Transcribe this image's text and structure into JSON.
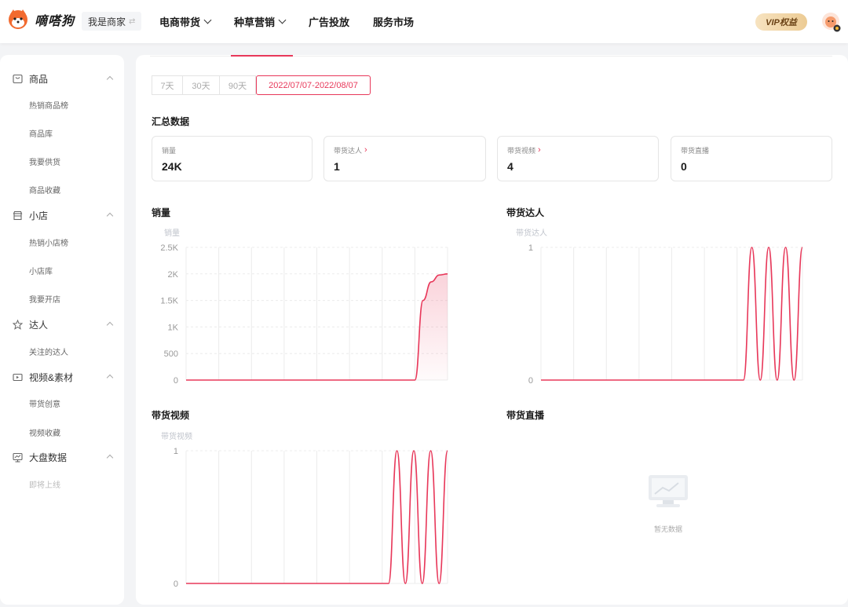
{
  "header": {
    "brand": "嘀嗒狗",
    "role_switch": "我是商家",
    "nav": [
      {
        "label": "电商带货",
        "dropdown": true
      },
      {
        "label": "种草营销",
        "dropdown": true
      },
      {
        "label": "广告投放",
        "dropdown": false
      },
      {
        "label": "服务市场",
        "dropdown": false
      }
    ],
    "vip_label": "VIP权益"
  },
  "sidebar": {
    "groups": [
      {
        "icon": "product-icon",
        "label": "商品",
        "items": [
          "热销商品榜",
          "商品库",
          "我要供货",
          "商品收藏"
        ]
      },
      {
        "icon": "store-icon",
        "label": "小店",
        "items": [
          "热销小店榜",
          "小店库",
          "我要开店"
        ]
      },
      {
        "icon": "star-person-icon",
        "label": "达人",
        "items": [
          "关注的达人"
        ]
      },
      {
        "icon": "video-icon",
        "label": "视频&素材",
        "items": [
          "带货创意",
          "视频收藏"
        ]
      },
      {
        "icon": "dashboard-icon",
        "label": "大盘数据",
        "items": [
          "即将上线"
        ]
      }
    ]
  },
  "date_range": {
    "options": [
      "7天",
      "30天",
      "90天",
      "2022/07/07-2022/08/07"
    ],
    "selected": "2022/07/07-2022/08/07"
  },
  "summary": {
    "title": "汇总数据",
    "cards": [
      {
        "label": "销量",
        "value": "24K",
        "link": false
      },
      {
        "label": "带货达人",
        "value": "1",
        "link": true
      },
      {
        "label": "带货视频",
        "value": "4",
        "link": true
      },
      {
        "label": "带货直播",
        "value": "0",
        "link": false
      }
    ]
  },
  "colors": {
    "accent": "#e8385a",
    "grid": "#ececec",
    "axis_text": "#999999"
  },
  "chart_data": [
    {
      "type": "area",
      "title": "销量",
      "ylabel": "销量",
      "ylim": [
        0,
        2500
      ],
      "yticks": [
        "0",
        "500",
        "1K",
        "1.5K",
        "2K",
        "2.5K"
      ],
      "y": [
        0,
        0,
        0,
        0,
        0,
        0,
        0,
        0,
        0,
        0,
        0,
        0,
        0,
        0,
        0,
        0,
        0,
        0,
        0,
        0,
        0,
        0,
        0,
        0,
        0,
        0,
        0,
        0,
        0,
        1500,
        1850,
        1980,
        2000
      ],
      "x_gridlines": 8
    },
    {
      "type": "line",
      "title": "带货达人",
      "ylabel": "带货达人",
      "ylim": [
        0,
        1
      ],
      "yticks": [
        "0",
        "1"
      ],
      "y": [
        0,
        0,
        0,
        0,
        0,
        0,
        0,
        0,
        0,
        0,
        0,
        0,
        0,
        0,
        0,
        0,
        0,
        0,
        0,
        0,
        0,
        0,
        0,
        0,
        0,
        1,
        0,
        1,
        0,
        1,
        0,
        1
      ],
      "x_gridlines": 8
    },
    {
      "type": "line",
      "title": "带货视频",
      "ylabel": "带货视频",
      "ylim": [
        0,
        1
      ],
      "yticks": [
        "0",
        "1"
      ],
      "y": [
        0,
        0,
        0,
        0,
        0,
        0,
        0,
        0,
        0,
        0,
        0,
        0,
        0,
        0,
        0,
        0,
        0,
        0,
        0,
        0,
        0,
        0,
        0,
        0,
        0,
        1,
        0,
        1,
        0,
        1,
        0,
        1
      ],
      "x_gridlines": 8
    }
  ],
  "live": {
    "title": "带货直播",
    "empty_text": "暂无数据"
  }
}
